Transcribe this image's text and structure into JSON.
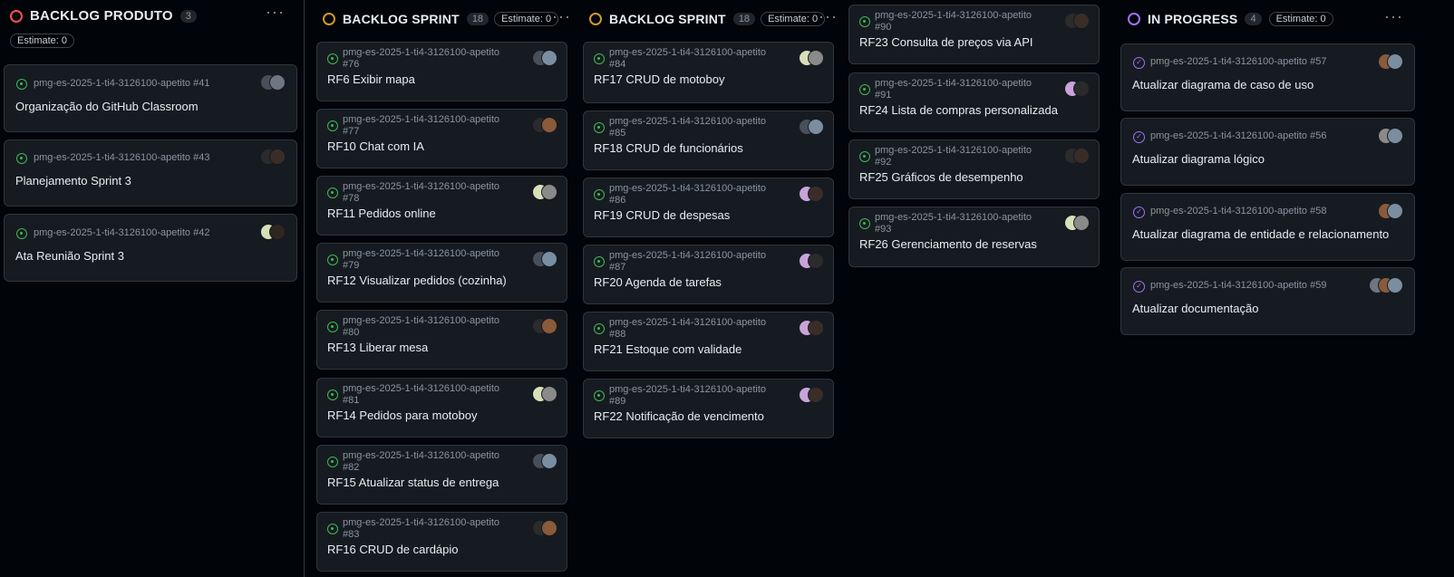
{
  "columns": {
    "backlog_produto": {
      "title": "BACKLOG PRODUTO",
      "count": "3",
      "estimate": "Estimate: 0",
      "status_color": "#f85149",
      "cards": [
        {
          "repo": "pmg-es-2025-1-ti4-3126100-apetito #41",
          "title": "Organização do GitHub Classroom"
        },
        {
          "repo": "pmg-es-2025-1-ti4-3126100-apetito #43",
          "title": "Planejamento Sprint 3"
        },
        {
          "repo": "pmg-es-2025-1-ti4-3126100-apetito #42",
          "title": "Ata Reunião Sprint 3"
        }
      ]
    },
    "backlog_sprint": {
      "title": "BACKLOG SPRINT",
      "count": "18",
      "estimate": "Estimate: 0",
      "status_color": "#d29922",
      "cards_a": [
        {
          "repo": "pmg-es-2025-1-ti4-3126100-apetito",
          "num": "#76",
          "title": "RF6 Exibir mapa"
        },
        {
          "repo": "pmg-es-2025-1-ti4-3126100-apetito",
          "num": "#77",
          "title": "RF10 Chat com IA"
        },
        {
          "repo": "pmg-es-2025-1-ti4-3126100-apetito",
          "num": "#78",
          "title": "RF11 Pedidos online"
        },
        {
          "repo": "pmg-es-2025-1-ti4-3126100-apetito",
          "num": "#79",
          "title": "RF12 Visualizar pedidos (cozinha)"
        },
        {
          "repo": "pmg-es-2025-1-ti4-3126100-apetito",
          "num": "#80",
          "title": "RF13 Liberar mesa"
        },
        {
          "repo": "pmg-es-2025-1-ti4-3126100-apetito",
          "num": "#81",
          "title": "RF14 Pedidos para motoboy"
        },
        {
          "repo": "pmg-es-2025-1-ti4-3126100-apetito",
          "num": "#82",
          "title": "RF15 Atualizar status de entrega"
        },
        {
          "repo": "pmg-es-2025-1-ti4-3126100-apetito",
          "num": "#83",
          "title": "RF16 CRUD de cardápio"
        }
      ],
      "cards_b": [
        {
          "repo": "pmg-es-2025-1-ti4-3126100-apetito",
          "num": "#84",
          "title": "RF17 CRUD de motoboy"
        },
        {
          "repo": "pmg-es-2025-1-ti4-3126100-apetito",
          "num": "#85",
          "title": "RF18 CRUD de funcionários"
        },
        {
          "repo": "pmg-es-2025-1-ti4-3126100-apetito",
          "num": "#86",
          "title": "RF19 CRUD de despesas"
        },
        {
          "repo": "pmg-es-2025-1-ti4-3126100-apetito",
          "num": "#87",
          "title": "RF20 Agenda de tarefas"
        },
        {
          "repo": "pmg-es-2025-1-ti4-3126100-apetito",
          "num": "#88",
          "title": "RF21 Estoque com validade"
        },
        {
          "repo": "pmg-es-2025-1-ti4-3126100-apetito",
          "num": "#89",
          "title": "RF22 Notificação de vencimento"
        }
      ],
      "cards_c": [
        {
          "repo": "pmg-es-2025-1-ti4-3126100-apetito",
          "num": "#90",
          "title": "RF23 Consulta de preços via API"
        },
        {
          "repo": "pmg-es-2025-1-ti4-3126100-apetito",
          "num": "#91",
          "title": "RF24 Lista de compras personalizada"
        },
        {
          "repo": "pmg-es-2025-1-ti4-3126100-apetito",
          "num": "#92",
          "title": "RF25 Gráficos de desempenho"
        },
        {
          "repo": "pmg-es-2025-1-ti4-3126100-apetito",
          "num": "#93",
          "title": "RF26 Gerenciamento de reservas"
        }
      ]
    },
    "in_progress": {
      "title": "IN PROGRESS",
      "count": "4",
      "estimate": "Estimate: 0",
      "status_color": "#a371f7",
      "cards": [
        {
          "repo": "pmg-es-2025-1-ti4-3126100-apetito #57",
          "title": "Atualizar diagrama de caso de uso"
        },
        {
          "repo": "pmg-es-2025-1-ti4-3126100-apetito #56",
          "title": "Atualizar diagrama lógico"
        },
        {
          "repo": "pmg-es-2025-1-ti4-3126100-apetito #58",
          "title": "Atualizar diagrama de entidade e relacionamento"
        },
        {
          "repo": "pmg-es-2025-1-ti4-3126100-apetito #59",
          "title": "Atualizar documentação"
        }
      ]
    }
  },
  "menu_icon": "kebab-menu-icon",
  "colors": {
    "open_issue": "#3fb950",
    "in_progress_issue": "#a371f7",
    "card_bg": "#161b22",
    "board_bg": "#010409"
  }
}
